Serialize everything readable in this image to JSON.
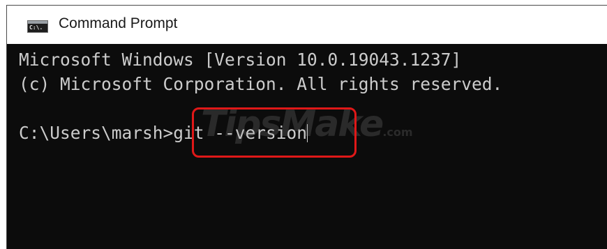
{
  "window": {
    "title": "Command Prompt",
    "icon_name": "command-prompt-icon",
    "icon_glyph": "C:\\."
  },
  "console": {
    "lines": [
      "Microsoft Windows [Version 10.0.19043.1237]",
      "(c) Microsoft Corporation. All rights reserved.",
      ""
    ],
    "prompt": "C:\\Users\\marsh>",
    "command": "git --version"
  },
  "watermark": {
    "text": "TipsMake",
    "suffix": ".com"
  },
  "colors": {
    "console_bg": "#0c0c0c",
    "console_text": "#cccccc",
    "highlight_border": "#e01818",
    "titlebar_bg": "#ffffff"
  }
}
